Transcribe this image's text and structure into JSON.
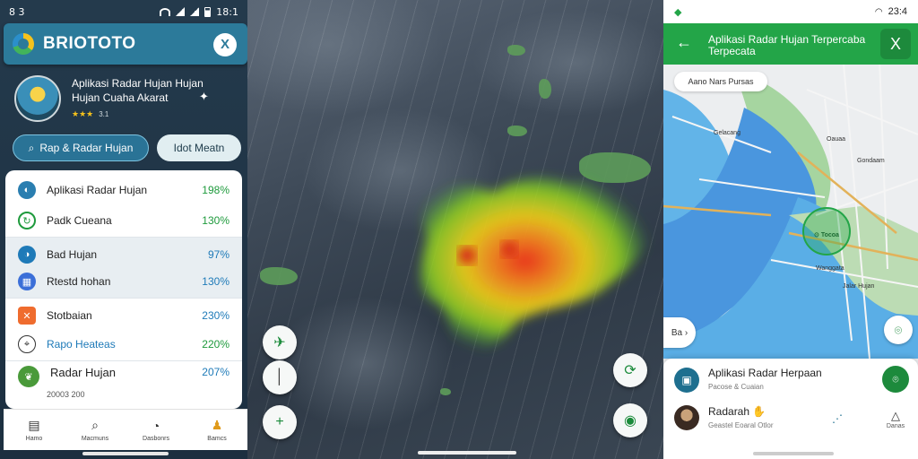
{
  "left": {
    "status": {
      "left": "8 3",
      "right": "18:1"
    },
    "header": {
      "title": "BRIOTOTO",
      "close": "X"
    },
    "info": {
      "title": "Aplikasi Radar Hujan Hujan",
      "subtitle": "Hujan Cuaha Akarat",
      "rating": "3.1"
    },
    "chips": {
      "radar": "Rap & Radar Hujan",
      "meta": "Idot Meatn"
    },
    "rows": [
      {
        "label": "Aplikasi Radar Hujan",
        "value": "198%",
        "color": "#1e9a3c"
      },
      {
        "label": "Padk Cueana",
        "value": "130%",
        "color": "#1e9a3c"
      },
      {
        "label": "Bad Hujan",
        "value": "97%",
        "color": "#1e7ab8"
      },
      {
        "label": "Rtestd hohan",
        "value": "130%",
        "color": "#1e7ab8"
      },
      {
        "label": "Stotbaian",
        "value": "230%",
        "color": "#1e7ab8"
      },
      {
        "label": "Rapo Heateas",
        "value": "220%",
        "color": "#1e9a3c"
      },
      {
        "label": "Radar Hujan",
        "sub": "20003 200",
        "value": "207%",
        "color": "#1e7ab8"
      }
    ],
    "nav": [
      "Hamo",
      "Macmuns",
      "Dasbonrs",
      "Bamcs"
    ]
  },
  "right": {
    "status": {
      "right": "23:4"
    },
    "header": {
      "title": "Aplikasi Radar Hujan Terpercaba Terpecata",
      "close": "X"
    },
    "chip": "Aano Nars Pursas",
    "marker": "Tocoa",
    "zoom": "Ba",
    "sheet": {
      "item1_title": "Aplikasi Radar Herpaan",
      "item1_sub": "Pacose & Cuaian",
      "item2_title": "Radarah",
      "item2_sub": "Geastel Eoaral Otlor",
      "item2_action": "Danas"
    },
    "map_labels": [
      "Gelacang",
      "Oauaa",
      "Gondaam",
      "Jalar Hujan",
      "Wanggata"
    ]
  }
}
